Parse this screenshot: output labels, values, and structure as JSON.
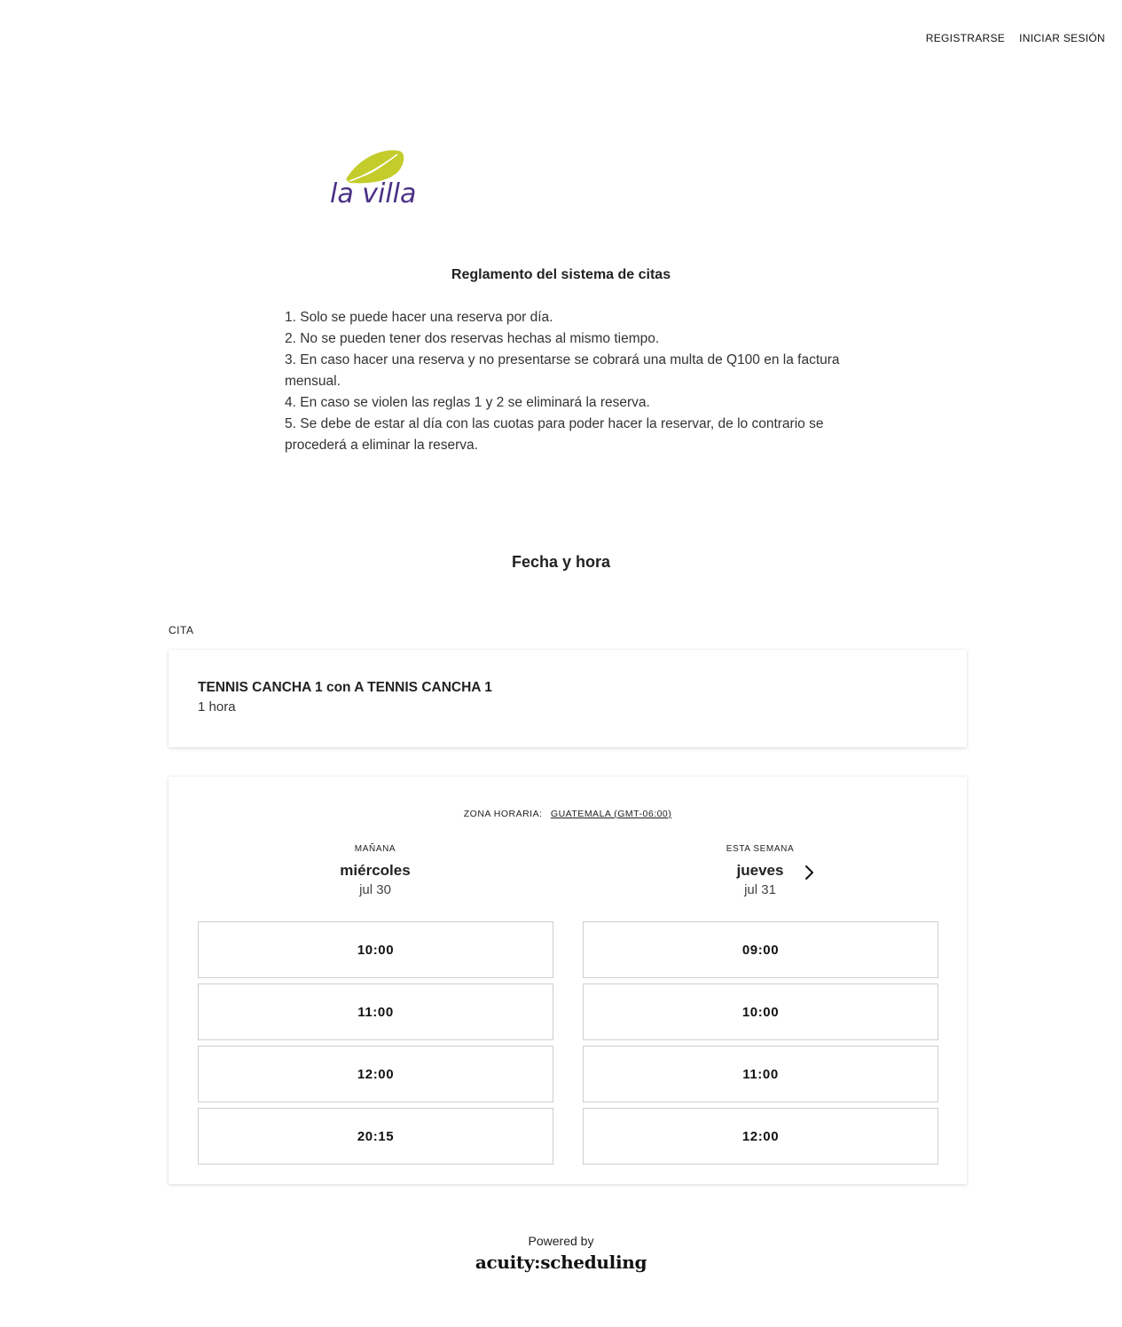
{
  "nav": {
    "register": "REGISTRARSE",
    "login": "INICIAR SESIÓN"
  },
  "logo": {
    "text": "la villa",
    "colors": {
      "leaf": "#c3cc2a",
      "text": "#4b2f85"
    }
  },
  "rules": {
    "title": "Reglamento del sistema de citas",
    "items": [
      "1. Solo se puede hacer una reserva por día.",
      "2. No se pueden tener dos reservas hechas al mismo tiempo.",
      "3. En caso hacer una reserva y no presentarse se cobrará una multa de Q100 en la factura mensual.",
      "4. En caso se violen las reglas 1 y 2 se eliminará la reserva.",
      "5. Se debe de estar al día con las cuotas para poder hacer la reservar, de lo contrario se procederá a eliminar la reserva."
    ]
  },
  "section": {
    "title": "Fecha y hora",
    "cita_label": "CITA"
  },
  "appointment": {
    "name": "TENNIS CANCHA 1 con A TENNIS CANCHA 1",
    "duration": "1 hora"
  },
  "calendar": {
    "timezone_label": "ZONA HORARIA:",
    "timezone_value": "GUATEMALA (GMT-06:00)",
    "days": [
      {
        "tag": "MAÑANA",
        "name": "miércoles",
        "date": "jul 30",
        "slots": [
          "10:00",
          "11:00",
          "12:00",
          "20:15"
        ]
      },
      {
        "tag": "ESTA SEMANA",
        "name": "jueves",
        "date": "jul 31",
        "slots": [
          "09:00",
          "10:00",
          "11:00",
          "12:00"
        ]
      }
    ],
    "next_icon": "chevron-right-icon"
  },
  "footer": {
    "powered_by": "Powered by",
    "brand": "acuity:scheduling"
  }
}
